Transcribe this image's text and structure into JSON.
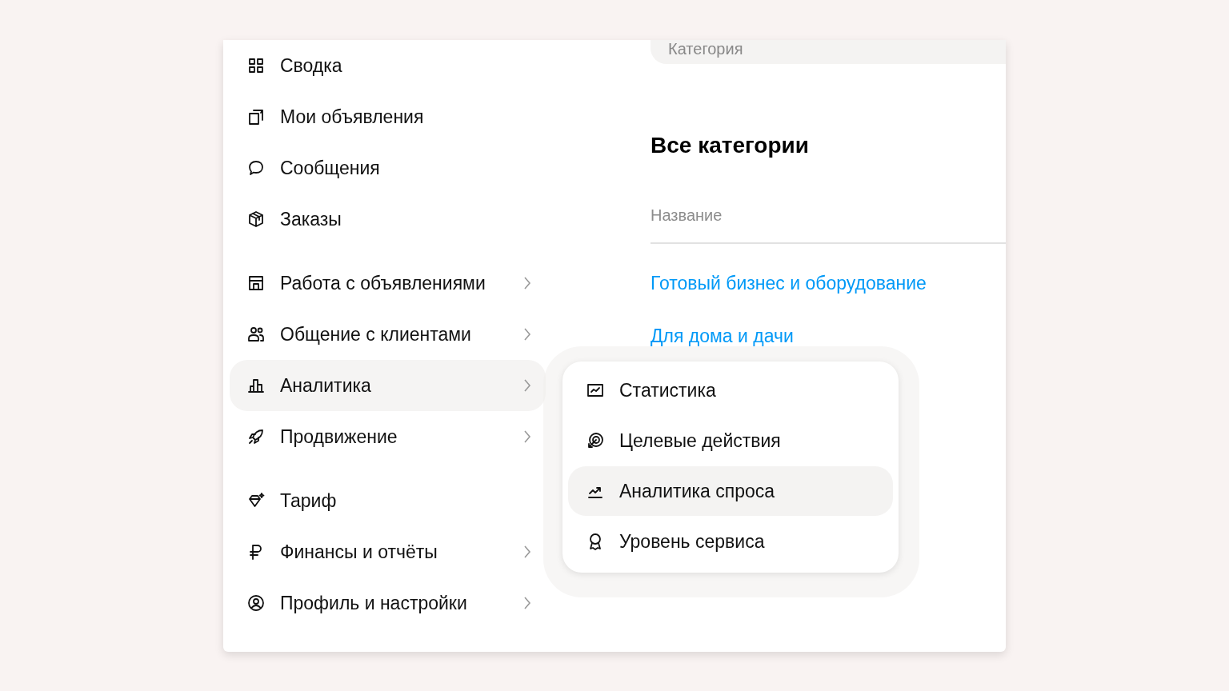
{
  "sidebar": {
    "groups": [
      {
        "items": [
          {
            "label": "Сводка",
            "selected": false,
            "has_submenu": false
          },
          {
            "label": "Мои объявления",
            "selected": false,
            "has_submenu": false
          },
          {
            "label": "Сообщения",
            "selected": false,
            "has_submenu": false
          },
          {
            "label": "Заказы",
            "selected": false,
            "has_submenu": false
          }
        ]
      },
      {
        "items": [
          {
            "label": "Работа с объявлениями",
            "selected": false,
            "has_submenu": true
          },
          {
            "label": "Общение с клиентами",
            "selected": false,
            "has_submenu": true
          },
          {
            "label": "Аналитика",
            "selected": true,
            "has_submenu": true
          },
          {
            "label": "Продвижение",
            "selected": false,
            "has_submenu": true
          }
        ]
      },
      {
        "items": [
          {
            "label": "Тариф",
            "selected": false,
            "has_submenu": false
          },
          {
            "label": "Финансы и отчёты",
            "selected": false,
            "has_submenu": true
          },
          {
            "label": "Профиль и настройки",
            "selected": false,
            "has_submenu": true
          }
        ]
      }
    ]
  },
  "submenu": {
    "items": [
      {
        "label": "Статистика",
        "selected": false
      },
      {
        "label": "Целевые действия",
        "selected": false
      },
      {
        "label": "Аналитика спроса",
        "selected": true
      },
      {
        "label": "Уровень сервиса",
        "selected": false
      }
    ]
  },
  "content": {
    "tab_label": "Категория",
    "title": "Все категории",
    "search": {
      "placeholder": "Название"
    },
    "links": [
      "Готовый бизнес и оборудование",
      "Для дома и дачи"
    ]
  }
}
